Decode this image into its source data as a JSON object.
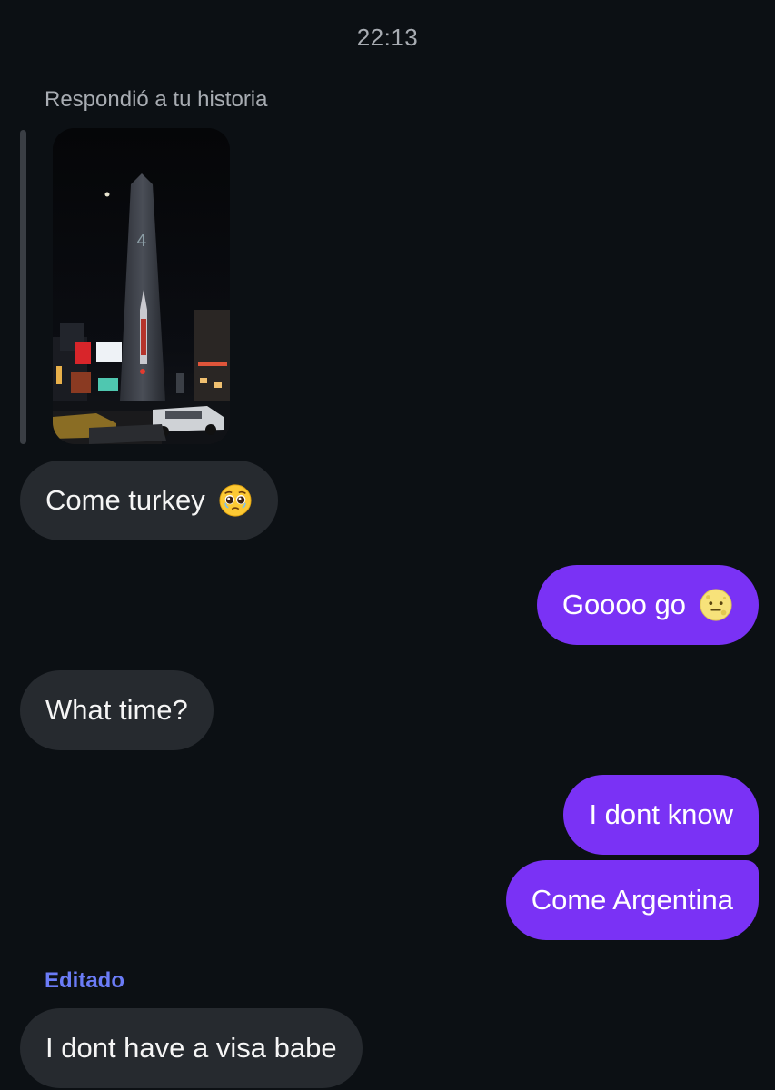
{
  "thread": {
    "timestamp": "22:13",
    "reply_context": "Respondió a tu historia"
  },
  "messages": [
    {
      "direction": "incoming",
      "text": "Come turkey",
      "emoji": "pleading-face-icon"
    },
    {
      "direction": "outgoing",
      "text": "Goooo go",
      "emoji": "moon-face-icon"
    },
    {
      "direction": "incoming",
      "text": "What time?"
    },
    {
      "direction": "outgoing",
      "text": "I dont know"
    },
    {
      "direction": "outgoing",
      "text": "Come Argentina"
    },
    {
      "direction": "incoming",
      "text": "I dont have a visa babe",
      "edited_label": "Editado"
    }
  ],
  "colors": {
    "background": "#0c1014",
    "incoming_bubble": "#262a2f",
    "outgoing_bubble": "#7a32f5",
    "edited_label": "#6b7cf7",
    "meta_text": "#a8acb2"
  }
}
